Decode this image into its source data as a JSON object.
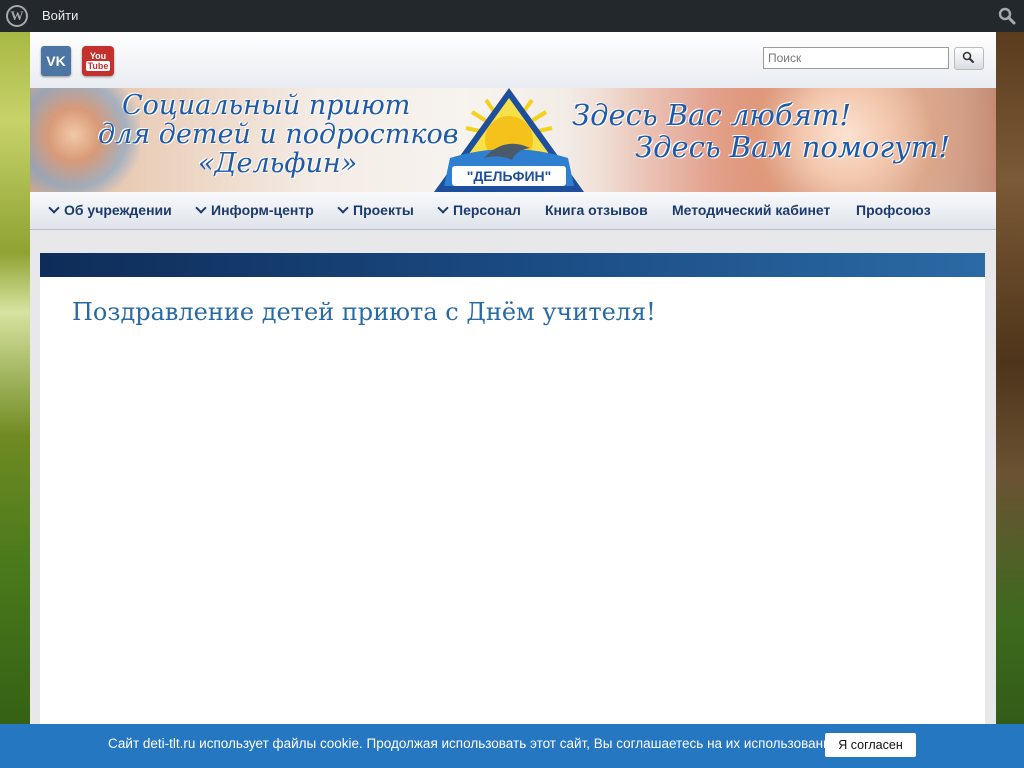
{
  "admin_bar": {
    "login_label": "Войти",
    "logo_icon": "wordpress-icon",
    "search_icon": "search-icon"
  },
  "header": {
    "social": {
      "vk_label": "VK",
      "youtube_label_top": "You",
      "youtube_label_bottom": "Tube"
    },
    "search": {
      "placeholder": "Поиск",
      "button_icon": "search-icon"
    },
    "banner": {
      "line1": "Социальный приют",
      "line2": "для детей и подростков",
      "line3": "«Дельфин»",
      "logo_text": "\"ДЕЛЬФИН\"",
      "slogan1": "Здесь Вас любят!",
      "slogan2": "Здесь Вам помогут!"
    }
  },
  "nav": {
    "items": [
      {
        "label": "Об учреждении",
        "has_dropdown": true
      },
      {
        "label": "Информ-центр",
        "has_dropdown": true
      },
      {
        "label": "Проекты",
        "has_dropdown": true
      },
      {
        "label": "Персонал",
        "has_dropdown": true
      },
      {
        "label": "Книга отзывов",
        "has_dropdown": false
      },
      {
        "label": "Методический кабинет",
        "has_dropdown": false
      },
      {
        "label": "Профсоюз",
        "has_dropdown": false
      }
    ]
  },
  "post": {
    "title": "Поздравление детей приюта с Днём учителя!"
  },
  "cookie": {
    "text": "Сайт deti-tlt.ru использует файлы cookie. Продолжая использовать этот сайт, Вы соглашаетесь на их использование.",
    "accept_label": "Я согласен"
  },
  "colors": {
    "admin_bar": "#23282d",
    "nav_text": "#1c3b6b",
    "title_text": "#2a6aa2",
    "cookie_bar": "#2677c2"
  }
}
